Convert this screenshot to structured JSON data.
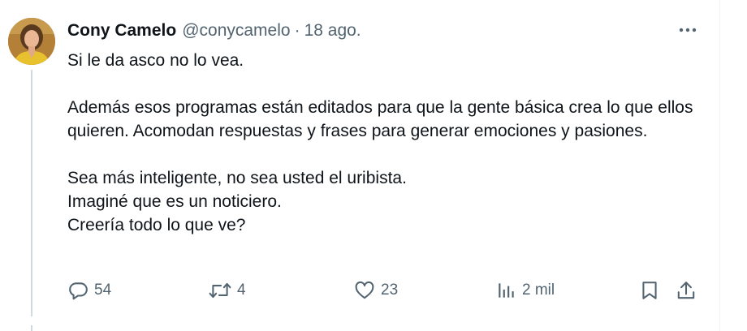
{
  "tweet": {
    "author_name": "Cony Camelo",
    "handle": "@conycamelo",
    "separator": "·",
    "date": "18 ago.",
    "body": [
      "Si le da asco no lo vea.",
      "Además esos programas están editados para que la gente básica crea lo que ellos quieren. Acomodan respuestas y frases para generar emociones y pasiones.",
      "Sea más inteligente, no sea usted el uribista.",
      "Imaginé que es un noticiero.",
      "Creería todo lo que ve?"
    ]
  },
  "actions": {
    "replies": "54",
    "retweets": "4",
    "likes": "23",
    "views": "2 mil"
  },
  "icons": {
    "more": "more-options-icon",
    "reply": "reply-icon",
    "retweet": "retweet-icon",
    "like": "heart-icon",
    "views": "analytics-icon",
    "bookmark": "bookmark-icon",
    "share": "share-icon"
  },
  "colors": {
    "text": "#0f1419",
    "secondary": "#536471",
    "thread_line": "#cfd9de",
    "avatar_jacket": "#e8c22e"
  }
}
